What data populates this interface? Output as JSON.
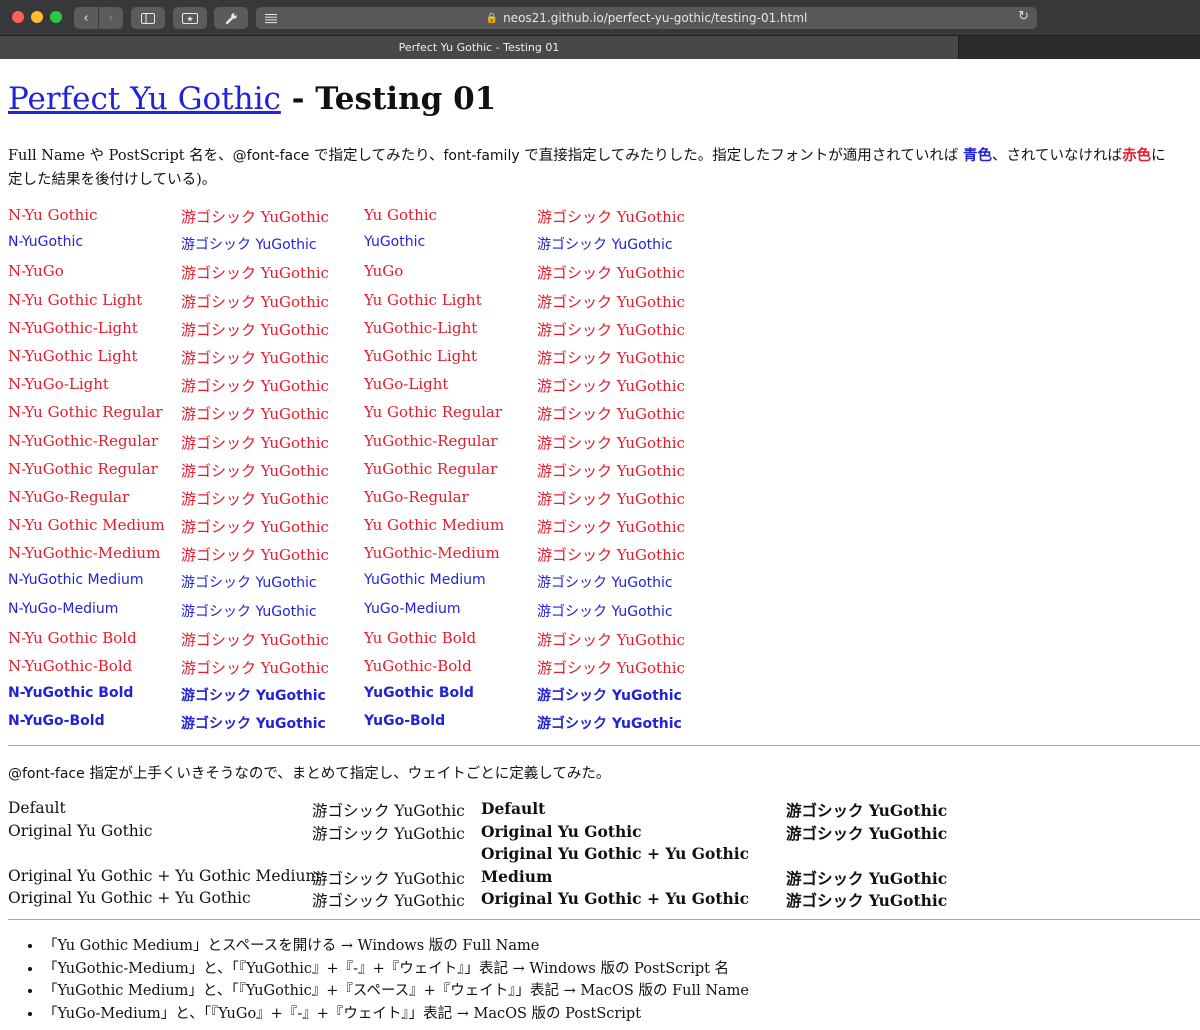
{
  "browser": {
    "url": "neos21.github.io/perfect-yu-gothic/testing-01.html",
    "tab_title": "Perfect Yu Gothic - Testing 01"
  },
  "page": {
    "title_link": "Perfect Yu Gothic",
    "title_rest": " - Testing 01",
    "intro": {
      "p1": "Full Name や PostScript 名を、",
      "code1": "@font-face",
      "p2": " で指定してみたり、",
      "code2": "font-family",
      "p3": " で直接指定してみたりした。指定したフォントが適用されていれば ",
      "blue": "青色",
      "p4": "、されていなければ",
      "red": "赤色",
      "p5": "に",
      "line2": "定した結果を後付けしている)。"
    },
    "rows": [
      {
        "c1": "N-Yu Gothic",
        "c2": "游ゴシック YuGothic",
        "c3": "Yu Gothic",
        "c4": "游ゴシック YuGothic",
        "style": "red"
      },
      {
        "c1": "N-YuGothic",
        "c2": "游ゴシック YuGothic",
        "c3": "YuGothic",
        "c4": "游ゴシック YuGothic",
        "style": "blue"
      },
      {
        "c1": "N-YuGo",
        "c2": "游ゴシック YuGothic",
        "c3": "YuGo",
        "c4": "游ゴシック YuGothic",
        "style": "red"
      },
      {
        "c1": "N-Yu Gothic Light",
        "c2": "游ゴシック YuGothic",
        "c3": "Yu Gothic Light",
        "c4": "游ゴシック YuGothic",
        "style": "red"
      },
      {
        "c1": "N-YuGothic-Light",
        "c2": "游ゴシック YuGothic",
        "c3": "YuGothic-Light",
        "c4": "游ゴシック YuGothic",
        "style": "red"
      },
      {
        "c1": "N-YuGothic Light",
        "c2": "游ゴシック YuGothic",
        "c3": "YuGothic Light",
        "c4": "游ゴシック YuGothic",
        "style": "red"
      },
      {
        "c1": "N-YuGo-Light",
        "c2": "游ゴシック YuGothic",
        "c3": "YuGo-Light",
        "c4": "游ゴシック YuGothic",
        "style": "red"
      },
      {
        "c1": "N-Yu Gothic Regular",
        "c2": "游ゴシック YuGothic",
        "c3": "Yu Gothic Regular",
        "c4": "游ゴシック YuGothic",
        "style": "red"
      },
      {
        "c1": "N-YuGothic-Regular",
        "c2": "游ゴシック YuGothic",
        "c3": "YuGothic-Regular",
        "c4": "游ゴシック YuGothic",
        "style": "red"
      },
      {
        "c1": "N-YuGothic Regular",
        "c2": "游ゴシック YuGothic",
        "c3": "YuGothic Regular",
        "c4": "游ゴシック YuGothic",
        "style": "red"
      },
      {
        "c1": "N-YuGo-Regular",
        "c2": "游ゴシック YuGothic",
        "c3": "YuGo-Regular",
        "c4": "游ゴシック YuGothic",
        "style": "red"
      },
      {
        "c1": "N-Yu Gothic Medium",
        "c2": "游ゴシック YuGothic",
        "c3": "Yu Gothic Medium",
        "c4": "游ゴシック YuGothic",
        "style": "red"
      },
      {
        "c1": "N-YuGothic-Medium",
        "c2": "游ゴシック YuGothic",
        "c3": "YuGothic-Medium",
        "c4": "游ゴシック YuGothic",
        "style": "red"
      },
      {
        "c1": "N-YuGothic Medium",
        "c2": "游ゴシック YuGothic",
        "c3": "YuGothic Medium",
        "c4": "游ゴシック YuGothic",
        "style": "blue"
      },
      {
        "c1": "N-YuGo-Medium",
        "c2": "游ゴシック YuGothic",
        "c3": "YuGo-Medium",
        "c4": "游ゴシック YuGothic",
        "style": "blue"
      },
      {
        "c1": "N-Yu Gothic Bold",
        "c2": "游ゴシック YuGothic",
        "c3": "Yu Gothic Bold",
        "c4": "游ゴシック YuGothic",
        "style": "red"
      },
      {
        "c1": "N-YuGothic-Bold",
        "c2": "游ゴシック YuGothic",
        "c3": "YuGothic-Bold",
        "c4": "游ゴシック YuGothic",
        "style": "red"
      },
      {
        "c1": "N-YuGothic Bold",
        "c2": "游ゴシック YuGothic",
        "c3": "YuGothic Bold",
        "c4": "游ゴシック YuGothic",
        "style": "blue-bold"
      },
      {
        "c1": "N-YuGo-Bold",
        "c2": "游ゴシック YuGothic",
        "c3": "YuGo-Bold",
        "c4": "游ゴシック YuGothic",
        "style": "blue-bold"
      }
    ],
    "note": {
      "code": "@font-face",
      "text": " 指定が上手くいきそうなので、まとめて指定し、ウェイトごとに定義してみた。"
    },
    "table2": [
      {
        "a": "Default",
        "b": "游ゴシック YuGothic",
        "c": "Default",
        "d": "游ゴシック YuGothic"
      },
      {
        "a": "Original Yu Gothic",
        "b": "游ゴシック YuGothic",
        "c": "Original Yu Gothic",
        "d": "游ゴシック YuGothic"
      },
      {
        "a": "Original Yu Gothic + Yu Gothic Medium",
        "b": "游ゴシック YuGothic",
        "c1": "Original Yu Gothic + Yu Gothic",
        "c2": "Medium",
        "d": "游ゴシック YuGothic"
      },
      {
        "a": "Original Yu Gothic + Yu Gothic",
        "b": "游ゴシック YuGothic",
        "c": "Original Yu Gothic + Yu Gothic",
        "d": "游ゴシック YuGothic"
      }
    ],
    "bullets": [
      "「Yu Gothic Medium」とスペースを開ける → Windows 版の Full Name",
      "「YuGothic-Medium」と、「『YuGothic』+『-』+『ウェイト』」表記 → Windows 版の PostScript 名",
      "「YuGothic Medium」と、「『YuGothic』+『スペース』+『ウェイト』」表記 → MacOS 版の Full Name",
      "「YuGo-Medium」と、「『YuGo』+『-』+『ウェイト』」表記 → MacOS 版の PostScript"
    ]
  },
  "colors": {
    "blue": "#2023d8",
    "red": "#e81a2b"
  }
}
